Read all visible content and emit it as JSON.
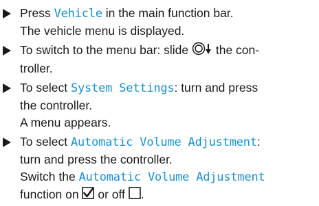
{
  "steps": [
    {
      "lines": [
        {
          "pre": "Press ",
          "kw": "Vehicle",
          "post": " in the main function bar."
        },
        {
          "text": "The vehicle menu is displayed."
        }
      ]
    },
    {
      "lines": [
        {
          "pre": "To switch to the menu bar: slide ",
          "post": " the con-"
        },
        {
          "text": "troller."
        }
      ],
      "icon": "controller-slide-down-icon"
    },
    {
      "lines": [
        {
          "pre": "To select ",
          "kw": "System Settings",
          "post": ": turn and press"
        },
        {
          "text": "the controller."
        },
        {
          "text": "A menu appears."
        }
      ]
    },
    {
      "lines": [
        {
          "pre": "To select ",
          "kw": "Automatic Volume Adjustment",
          "post": ":"
        },
        {
          "text": "turn and press the controller."
        },
        {
          "pre": "Switch the ",
          "kw": "Automatic Volume Adjustment"
        },
        {
          "pre": "function on ",
          "mid": " or off ",
          "post": "."
        }
      ],
      "icons": [
        "checkbox-checked-icon",
        "checkbox-empty-icon"
      ]
    }
  ],
  "colors": {
    "keyword": "#1591d6",
    "text": "#1a1a1a"
  }
}
